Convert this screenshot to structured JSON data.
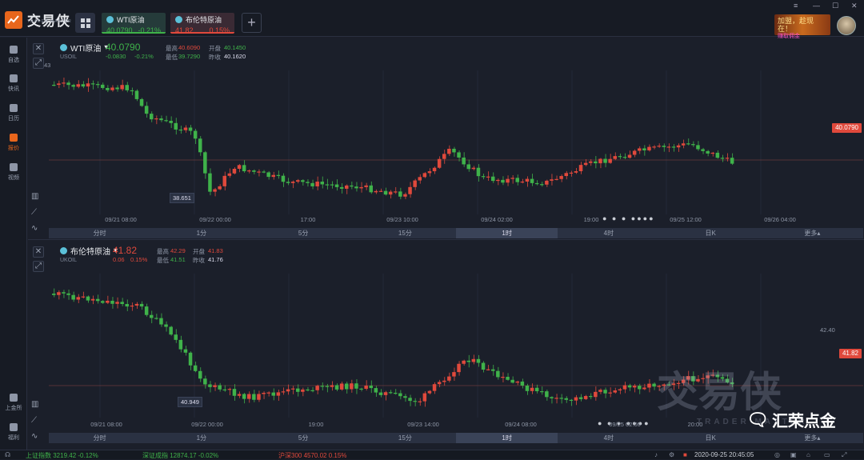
{
  "app": {
    "name": "交易侠",
    "subtitle": "TRADER MASTER"
  },
  "tabs": [
    {
      "name": "WTI原油",
      "price": "40.0790",
      "change": "-0.21%",
      "active": true
    },
    {
      "name": "布伦特原油",
      "price": "41.82",
      "change": "0.15%",
      "active": false
    }
  ],
  "promo": {
    "line1": "加盟，趁现在！",
    "line2": "赚取佣金"
  },
  "sidebar": [
    {
      "label": "自选",
      "icon": "bookmark-icon"
    },
    {
      "label": "快讯",
      "icon": "news-icon"
    },
    {
      "label": "日历",
      "icon": "calendar-icon"
    },
    {
      "label": "报价",
      "icon": "quote-icon",
      "active": true
    },
    {
      "label": "视频",
      "icon": "video-icon"
    },
    {
      "label": "上金所",
      "icon": "exchange-icon"
    },
    {
      "label": "福利",
      "icon": "gift-icon"
    }
  ],
  "timeframes": [
    "分时",
    "1分",
    "5分",
    "15分",
    "1时",
    "4时",
    "日K",
    "更多▴"
  ],
  "selected_timeframe": "1时",
  "colors": {
    "up": "#e0493c",
    "down": "#3fb24a",
    "accent": "#e8661c"
  },
  "charts": [
    {
      "name": "WTI原油",
      "code": "USOIL",
      "price": "40.0790",
      "change": "-0.0830",
      "change_pct": "-0.21%",
      "high_label": "最高",
      "high": "40.6090",
      "open_label": "开盘",
      "open": "40.1450",
      "low_label": "最低",
      "low": "39.7290",
      "prev_label": "昨收",
      "prev": "40.1620",
      "price_tag": "40.0790",
      "low_tag": "38.651",
      "y_tick": "43",
      "x_labels": [
        "09/21 08:00",
        "09/22 00:00",
        "17:00",
        "09/23 10:00",
        "09/24 02:00",
        "19:00",
        "09/25 12:00",
        "09/26 04:00"
      ]
    },
    {
      "name": "布伦特原油",
      "code": "UKOIL",
      "price": "41.82",
      "change": "0.06",
      "change_pct": "0.15%",
      "high_label": "最高",
      "high": "42.29",
      "open_label": "开盘",
      "open": "41.83",
      "low_label": "最低",
      "low": "41.51",
      "prev_label": "昨收",
      "prev": "41.76",
      "price_tag": "41.82",
      "low_tag": "40.949",
      "y_tick": "42.40",
      "x_labels": [
        "09/21 08:00",
        "09/22 00:00",
        "19:00",
        "09/23 14:00",
        "09/24 08:00",
        "09/25 02:00",
        "20:00"
      ]
    }
  ],
  "statusbar": {
    "items": [
      "上证指数 3219.42 -0.12%",
      "深证成指 12874.17 -0.02%",
      "沪深300 4570.02 0.15%"
    ],
    "datetime": "2020-09-25 20:45:05"
  },
  "watermark": {
    "logo": "交易侠",
    "sub": "TRADER MASTER",
    "wechat": "汇荣点金"
  }
}
